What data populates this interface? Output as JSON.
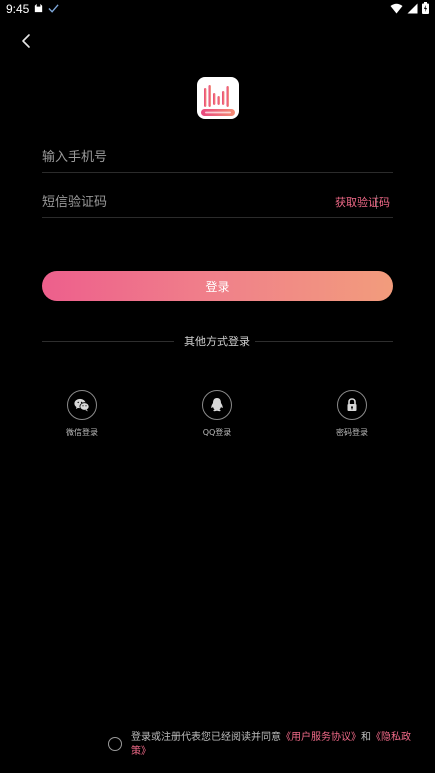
{
  "status_bar": {
    "time": "9:45"
  },
  "login": {
    "phone_placeholder": "输入手机号",
    "code_placeholder": "短信验证码",
    "get_code_label": "获取验证码",
    "submit_label": "登录"
  },
  "other_methods": {
    "title": "其他方式登录",
    "items": [
      {
        "label": "微信登录",
        "icon": "wechat-icon"
      },
      {
        "label": "QQ登录",
        "icon": "qq-icon"
      },
      {
        "label": "密码登录",
        "icon": "lock-icon"
      }
    ]
  },
  "agreement": {
    "prefix": "登录或注册代表您已经阅读并同意",
    "user_agreement": "《用户服务协议》",
    "and": "和",
    "privacy_policy": "《隐私政策》"
  },
  "colors": {
    "accent": "#f06a88",
    "gradient_start": "#ed5f8c",
    "gradient_end": "#f29c7c",
    "background": "#000000"
  }
}
